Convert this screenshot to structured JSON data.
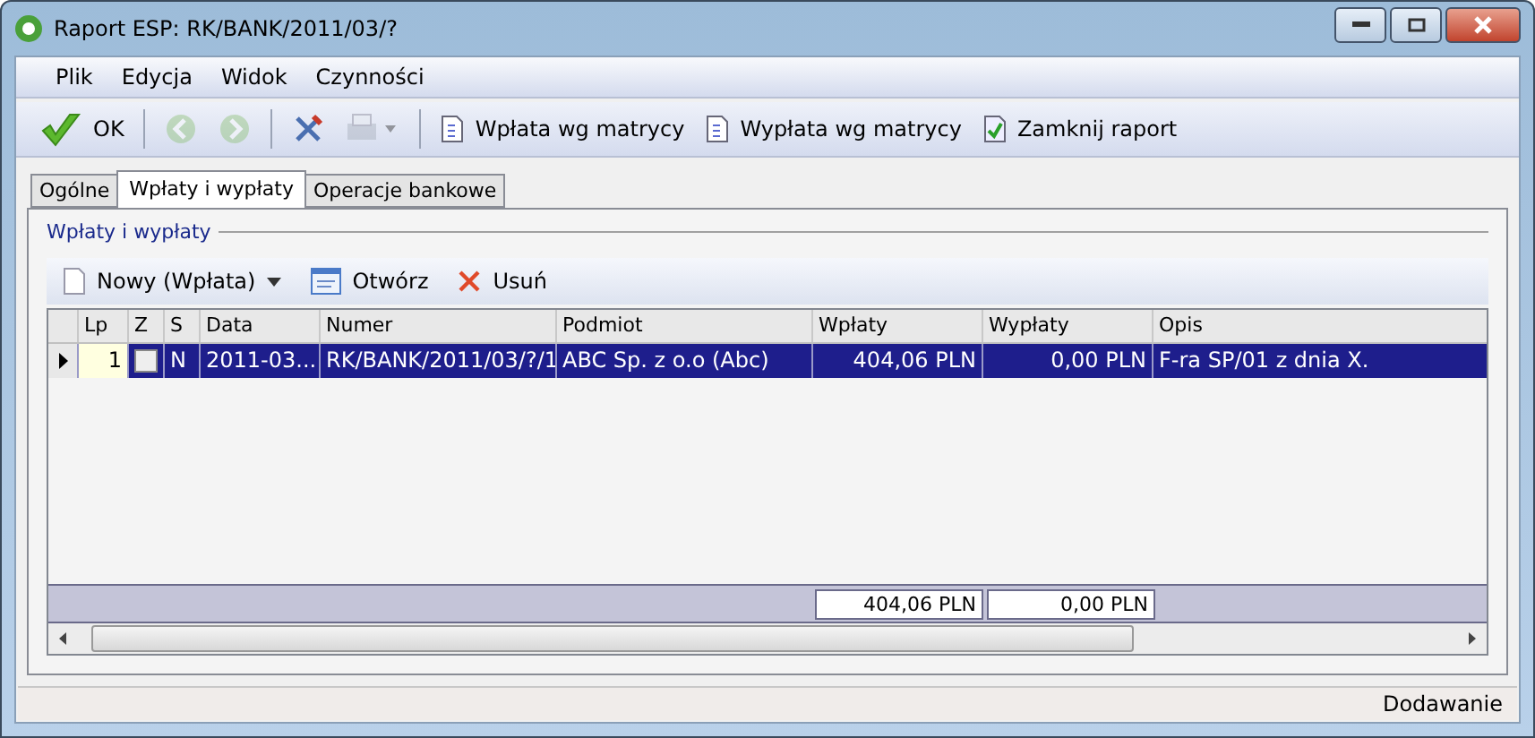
{
  "window": {
    "title": "Raport ESP: RK/BANK/2011/03/?"
  },
  "menu": [
    "Plik",
    "Edycja",
    "Widok",
    "Czynności"
  ],
  "toolbar": [
    {
      "kind": "ok",
      "label": "OK",
      "disabled": false
    },
    {
      "kind": "back",
      "disabled": true
    },
    {
      "kind": "forward",
      "disabled": true
    },
    {
      "kind": "tools",
      "disabled": false
    },
    {
      "kind": "print",
      "disabled": true
    },
    {
      "kind": "doc",
      "label": "Wpłata wg matrycy",
      "disabled": false
    },
    {
      "kind": "doc",
      "label": "Wypłata wg matrycy",
      "disabled": false
    },
    {
      "kind": "check",
      "label": "Zamknij raport",
      "disabled": false
    }
  ],
  "tabs": [
    {
      "label": "Ogólne",
      "selected": false
    },
    {
      "label": "Wpłaty i wypłaty",
      "selected": true
    },
    {
      "label": "Operacje bankowe",
      "selected": false
    }
  ],
  "group": {
    "title": "Wpłaty i wypłaty"
  },
  "grid_toolbar": [
    {
      "kind": "new",
      "label": "Nowy (Wpłata)"
    },
    {
      "kind": "open",
      "label": "Otwórz"
    },
    {
      "kind": "delete",
      "label": "Usuń"
    }
  ],
  "table": {
    "columns": [
      "Lp",
      "Z",
      "S",
      "Data",
      "Numer",
      "Podmiot",
      "Wpłaty",
      "Wypłaty",
      "Opis"
    ],
    "rows": [
      {
        "selected": true,
        "lp": "1",
        "z_checked": false,
        "s": "N",
        "data": "2011-03...",
        "numer": "RK/BANK/2011/03/?/1",
        "podmiot": "ABC Sp. z o.o (Abc)",
        "wplaty": "404,06 PLN",
        "wyplaty": "0,00 PLN",
        "opis": "F-ra SP/01 z dnia X."
      }
    ],
    "totals": {
      "wplaty": "404,06 PLN",
      "wyplaty": "0,00 PLN"
    }
  },
  "status_bar": "Dodawanie"
}
